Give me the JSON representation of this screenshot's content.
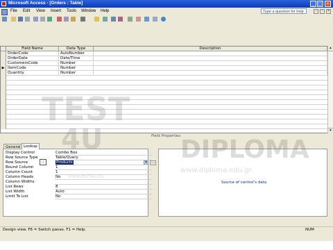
{
  "window": {
    "title": "Microsoft Access - [Orders : Table]"
  },
  "menu": {
    "items": [
      "File",
      "Edit",
      "View",
      "Insert",
      "Tools",
      "Window",
      "Help"
    ],
    "help_placeholder": "Type a question for help"
  },
  "grid": {
    "headers": [
      "Field Name",
      "Data Type",
      "Description"
    ],
    "rows": [
      {
        "field": "OrderCode",
        "type": "AutoNumber",
        "selector": ""
      },
      {
        "field": "OrderDate",
        "type": "Date/Time",
        "selector": ""
      },
      {
        "field": "CustomersCode",
        "type": "Number",
        "selector": ""
      },
      {
        "field": "ItemCode",
        "type": "Number",
        "selector": "▶"
      },
      {
        "field": "Quantity",
        "type": "Number",
        "selector": ""
      }
    ]
  },
  "field_properties": {
    "title": "Field Properties",
    "tabs": [
      "General",
      "Lookup"
    ],
    "active_tab": "Lookup",
    "properties": [
      {
        "label": "Display Control",
        "value": "Combo Box"
      },
      {
        "label": "Row Source Type",
        "value": "Table/Query"
      },
      {
        "label": "Row Source",
        "value": "Products"
      },
      {
        "label": "Bound Column",
        "value": "1"
      },
      {
        "label": "Column Count",
        "value": "1"
      },
      {
        "label": "Column Heads",
        "value": "No"
      },
      {
        "label": "Column Widths",
        "value": ""
      },
      {
        "label": "List Rows",
        "value": "8"
      },
      {
        "label": "List Width",
        "value": "Auto"
      },
      {
        "label": "Limit To List",
        "value": "No"
      }
    ],
    "help_text": "Source of control's data"
  },
  "status": {
    "left": "Design view.  F6 = Switch panes.  F1 = Help.",
    "right": "NUM"
  },
  "watermark": {
    "line1": "TEST",
    "line2": "4U",
    "brand": "DIPLOMA",
    "url": "www.diploma.edu.gr",
    "small_url": "www.test4u.eu"
  },
  "colors": {
    "titlebar": "#0a3bbf",
    "chrome": "#ece9d8",
    "help_text": "#0b2e9c"
  }
}
